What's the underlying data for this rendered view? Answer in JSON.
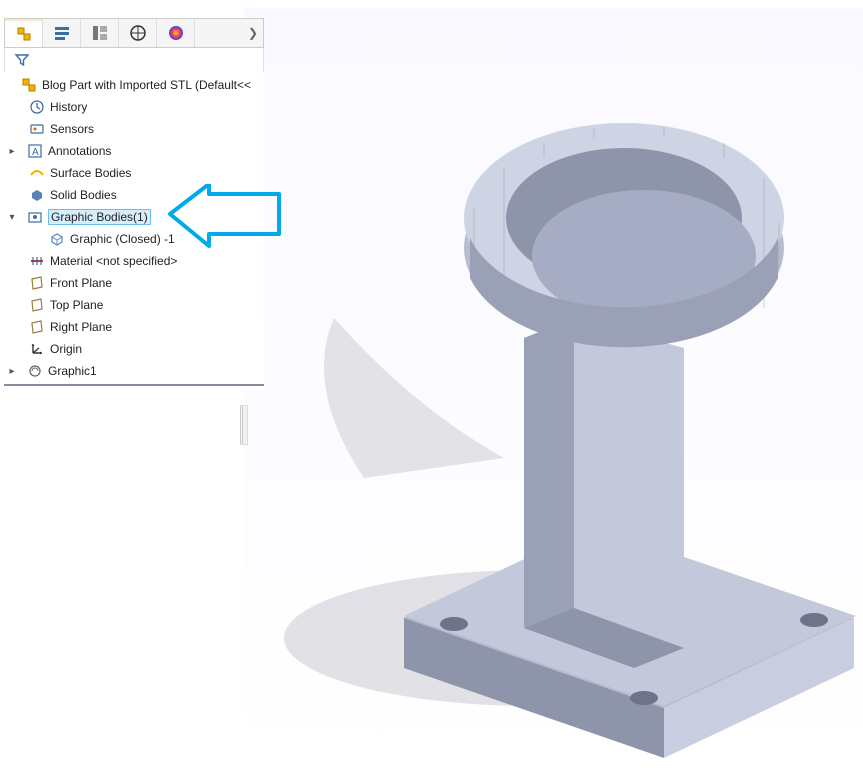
{
  "tabs": {
    "arrow": "❯"
  },
  "tree": {
    "root": "Blog Part with Imported STL  (Default<<",
    "history": "History",
    "sensors": "Sensors",
    "annotations": "Annotations",
    "surfaceBodies": "Surface Bodies",
    "solidBodies": "Solid Bodies",
    "graphicBodies": "Graphic Bodies(1)",
    "graphicClosed": "Graphic (Closed) -1",
    "material": "Material <not specified>",
    "frontPlane": "Front Plane",
    "topPlane": "Top Plane",
    "rightPlane": "Right Plane",
    "origin": "Origin",
    "graphic1": "Graphic1"
  },
  "colors": {
    "annotation": "#00aaea",
    "part": "#a6acc3",
    "partShadow": "#bfbfc8"
  }
}
